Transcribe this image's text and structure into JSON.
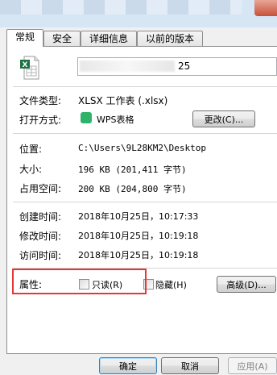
{
  "tabs": [
    {
      "label": "常规"
    },
    {
      "label": "安全"
    },
    {
      "label": "详细信息"
    },
    {
      "label": "以前的版本"
    }
  ],
  "file": {
    "name_visible": "25",
    "icon": "xlsx-file-icon"
  },
  "labels": {
    "file_type": "文件类型:",
    "open_with": "打开方式:",
    "location": "位置:",
    "size": "大小:",
    "size_on_disk": "占用空间:",
    "created": "创建时间:",
    "modified": "修改时间:",
    "accessed": "访问时间:",
    "attributes": "属性:"
  },
  "values": {
    "file_type": "XLSX 工作表 (.xlsx)",
    "open_with": "WPS表格",
    "location": "C:\\Users\\9L28KM2\\Desktop",
    "size": "196 KB (201,411 字节)",
    "size_on_disk": "200 KB (204,800 字节)",
    "created": "2018年10月25日，10:17:33",
    "modified": "2018年10月25日，10:19:18",
    "accessed": "2018年10月25日，10:19:18"
  },
  "attributes": {
    "readonly_label": "只读(R)",
    "hidden_label": "隐藏(H)",
    "readonly_checked": false,
    "hidden_checked": false
  },
  "buttons": {
    "change": "更改(C)...",
    "advanced": "高级(D)...",
    "ok": "确定",
    "cancel": "取消",
    "apply": "应用(A)"
  },
  "colors": {
    "highlight": "#e53935",
    "wps_green": "#2fb36b",
    "excel_green": "#1e7145"
  }
}
